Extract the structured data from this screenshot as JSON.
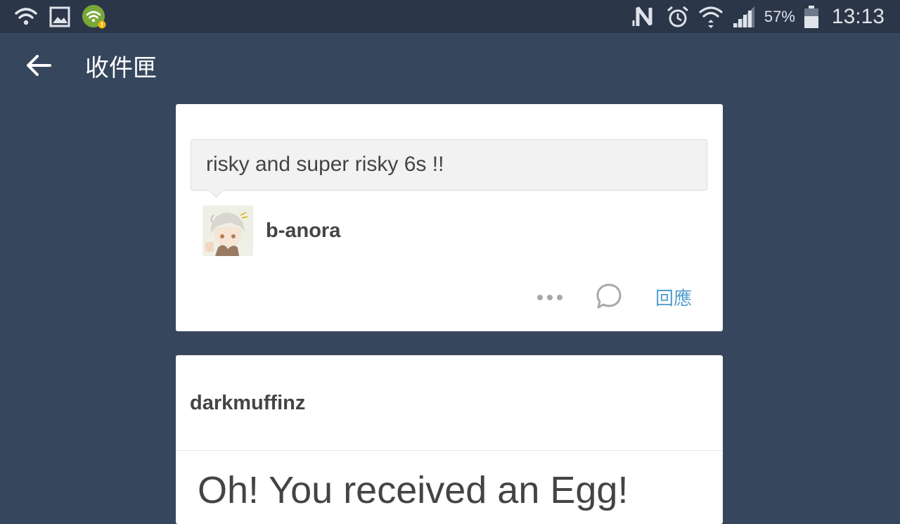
{
  "status_bar": {
    "battery_percent": "57%",
    "time": "13:13",
    "icons_left": [
      "wifi-icon",
      "image-icon",
      "wifi-alert-app-icon"
    ],
    "icons_right": [
      "nfc-icon",
      "alarm-icon",
      "wifi-data-icon",
      "signal-icon",
      "battery-icon"
    ]
  },
  "app_bar": {
    "title": "收件匣",
    "back_icon": "arrow-left-icon"
  },
  "message_card": {
    "message": "risky and super risky 6s !!",
    "username": "b-anora",
    "avatar_icon": "anime-avatar",
    "actions": {
      "more_icon": "more-dots-icon",
      "comment_icon": "comment-bubble-icon",
      "reply_label": "回應",
      "reply_color": "#529ecc"
    }
  },
  "post_card": {
    "author": "darkmuffinz",
    "heading": "Oh! You received an Egg!"
  },
  "colors": {
    "background": "#36465d",
    "status_bar": "#2b3648",
    "card": "#ffffff"
  }
}
